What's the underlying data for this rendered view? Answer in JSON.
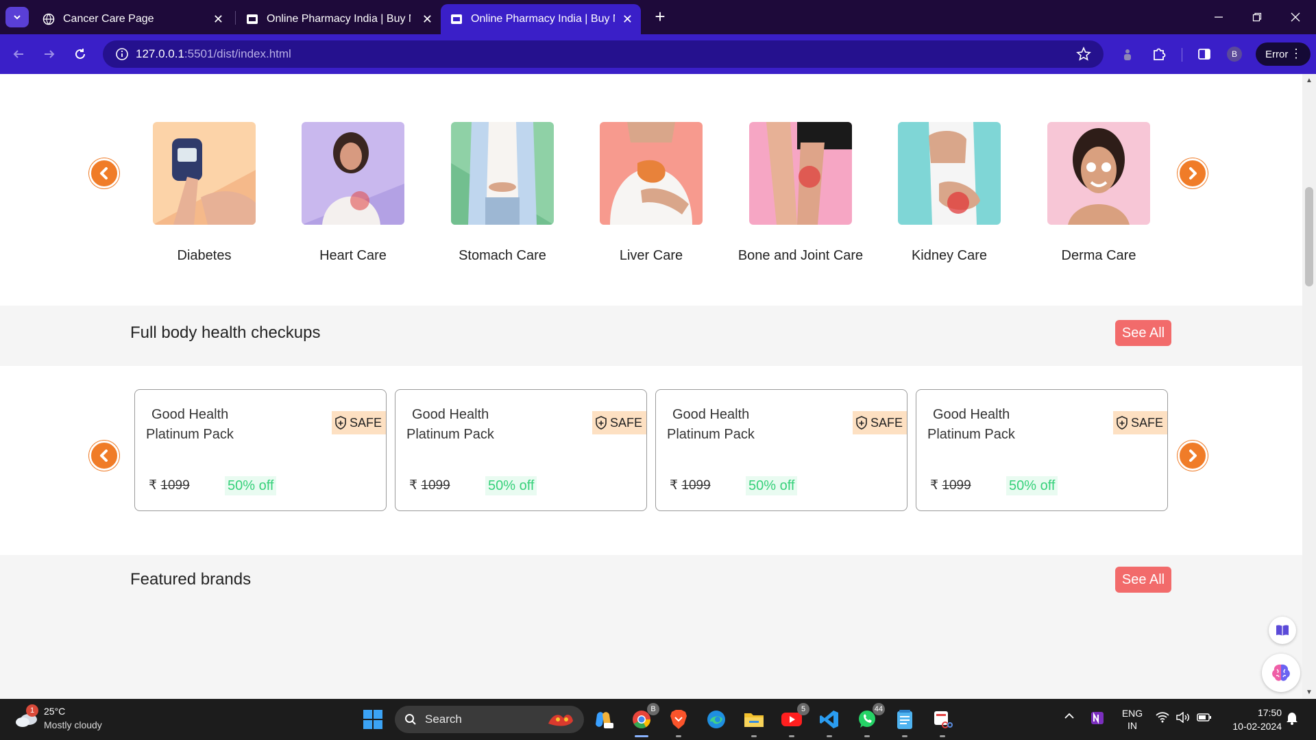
{
  "browser": {
    "tabs": [
      {
        "title": "Cancer Care Page",
        "active": false
      },
      {
        "title": "Online Pharmacy India | Buy Me",
        "active": false
      },
      {
        "title": "Online Pharmacy India | Buy Me",
        "active": true
      }
    ],
    "url_host": "127.0.0.1",
    "url_rest": ":5501/dist/index.html",
    "profile_initial": "B",
    "error_label": "Error"
  },
  "categories": {
    "items": [
      {
        "label": "Diabetes",
        "bg": "#fcd3a8"
      },
      {
        "label": "Heart Care",
        "bg": "#c9b8ee"
      },
      {
        "label": "Stomach Care",
        "bg": "#8fd1a6"
      },
      {
        "label": "Liver Care",
        "bg": "#f79a8e"
      },
      {
        "label": "Bone and Joint Care",
        "bg": "#f6a6c4"
      },
      {
        "label": "Kidney Care",
        "bg": "#7fd6d6"
      },
      {
        "label": "Derma Care",
        "bg": "#f7c6d6"
      }
    ]
  },
  "checkups": {
    "title": "Full body health checkups",
    "see_all": "See All",
    "cards": [
      {
        "line1": "Good Health",
        "line2": "Platinum Pack",
        "badge": "SAFE",
        "currency": "₹",
        "price": "1099",
        "discount": "50% off"
      },
      {
        "line1": "Good Health",
        "line2": "Platinum Pack",
        "badge": "SAFE",
        "currency": "₹",
        "price": "1099",
        "discount": "50% off"
      },
      {
        "line1": "Good Health",
        "line2": "Platinum Pack",
        "badge": "SAFE",
        "currency": "₹",
        "price": "1099",
        "discount": "50% off"
      },
      {
        "line1": "Good Health",
        "line2": "Platinum Pack",
        "badge": "SAFE",
        "currency": "₹",
        "price": "1099",
        "discount": "50% off"
      }
    ]
  },
  "brands": {
    "title": "Featured brands",
    "see_all": "See All"
  },
  "taskbar": {
    "weather_temp": "25°C",
    "weather_cond": "Mostly cloudy",
    "weather_badge": "1",
    "search_label": "Search",
    "chrome_badge": "B",
    "youtube_badge": "5",
    "whatsapp_badge": "44",
    "lang_top": "ENG",
    "lang_bottom": "IN",
    "time": "17:50",
    "date": "10-02-2024"
  },
  "colors": {
    "accent_orange": "#f07c28",
    "see_all_red": "#f26b6b",
    "discount_green": "#36d17a",
    "safe_bg": "#fde0c2",
    "browser_purple": "#3a1fc8"
  }
}
